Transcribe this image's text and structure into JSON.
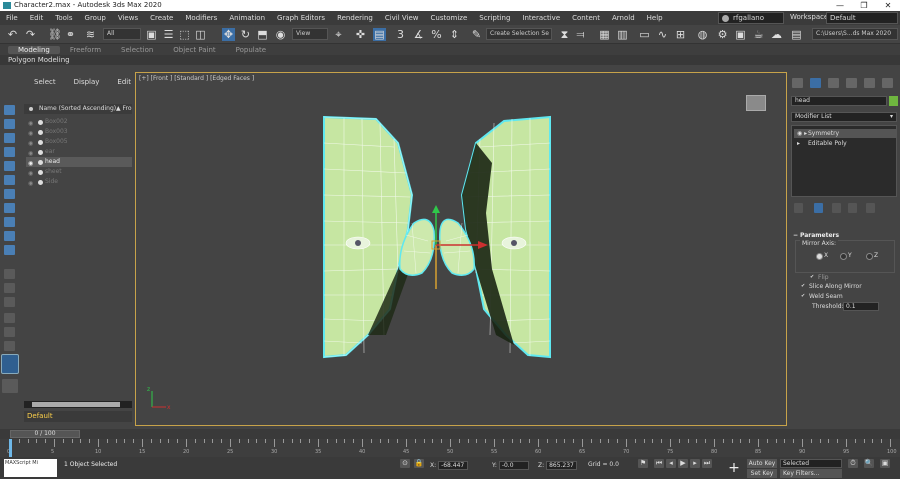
{
  "window": {
    "title": "Character2.max - Autodesk 3ds Max 2020",
    "controls": [
      "—",
      "❐",
      "✕"
    ]
  },
  "menubar": {
    "items": [
      "File",
      "Edit",
      "Tools",
      "Group",
      "Views",
      "Create",
      "Modifiers",
      "Animation",
      "Graph Editors",
      "Rendering",
      "Civil View",
      "Customize",
      "Scripting",
      "Interactive",
      "Content",
      "Arnold",
      "Help"
    ],
    "user": "rfgallano",
    "workspaces_label": "Workspaces:",
    "workspace_value": "Default"
  },
  "toolbar": {
    "filter_select": "All",
    "ref_coord_select": "View",
    "create_selection_set": "Create Selection Se",
    "project_path": "C:\\Users\\S...ds Max 2020"
  },
  "ribbon": {
    "tabs": [
      "Modeling",
      "Freeform",
      "Selection",
      "Object Paint",
      "Populate"
    ],
    "active_tab": "Modeling",
    "sub_label": "Polygon Modeling"
  },
  "scene_explorer": {
    "menu": [
      "Select",
      "Display",
      "Edit"
    ],
    "column_name": "Name (Sorted Ascending)",
    "column_sort": "▲ Fro",
    "rows": [
      {
        "name": "Box002",
        "selected": false
      },
      {
        "name": "Box003",
        "selected": false
      },
      {
        "name": "Box005",
        "selected": false
      },
      {
        "name": "ear",
        "selected": false
      },
      {
        "name": "head",
        "selected": true
      },
      {
        "name": "sheet",
        "selected": false
      },
      {
        "name": "Side",
        "selected": false
      }
    ],
    "layer": "Default"
  },
  "viewport": {
    "label": "[+] [Front ] [Standard ] [Edged Faces ]"
  },
  "command_panel": {
    "object_name": "head",
    "modifier_list": "Modifier List",
    "stack": [
      {
        "name": "Symmetry",
        "selected": true
      },
      {
        "name": "Editable Poly",
        "selected": false
      }
    ],
    "parameters": {
      "title": "Parameters",
      "mirror_axis_label": "Mirror Axis:",
      "axes": [
        "X",
        "Y",
        "Z"
      ],
      "selected_axis": "X",
      "flip": "Flip",
      "slice_along_mirror": "Slice Along Mirror",
      "weld_seam": "Weld Seam",
      "threshold_label": "Threshold:",
      "threshold_value": "0.1"
    }
  },
  "timeline": {
    "frame_display": "0 / 100",
    "tick_labels": [
      "0",
      "5",
      "10",
      "15",
      "20",
      "25",
      "30",
      "35",
      "40",
      "45",
      "50",
      "55",
      "60",
      "65",
      "70",
      "75",
      "80",
      "85",
      "90",
      "95",
      "100"
    ]
  },
  "status": {
    "maxscript": "MAXScript Mi",
    "selected_text": "1 Object Selected",
    "x_label": "X:",
    "x_value": "-68.447",
    "y_label": "Y:",
    "y_value": "-0.0",
    "z_label": "Z:",
    "z_value": "865.237",
    "grid": "Grid = 0.0",
    "auto_key": "Auto Key",
    "set_key": "Set Key",
    "selected_dropdown": "Selected",
    "key_filters": "Key Filters..."
  }
}
